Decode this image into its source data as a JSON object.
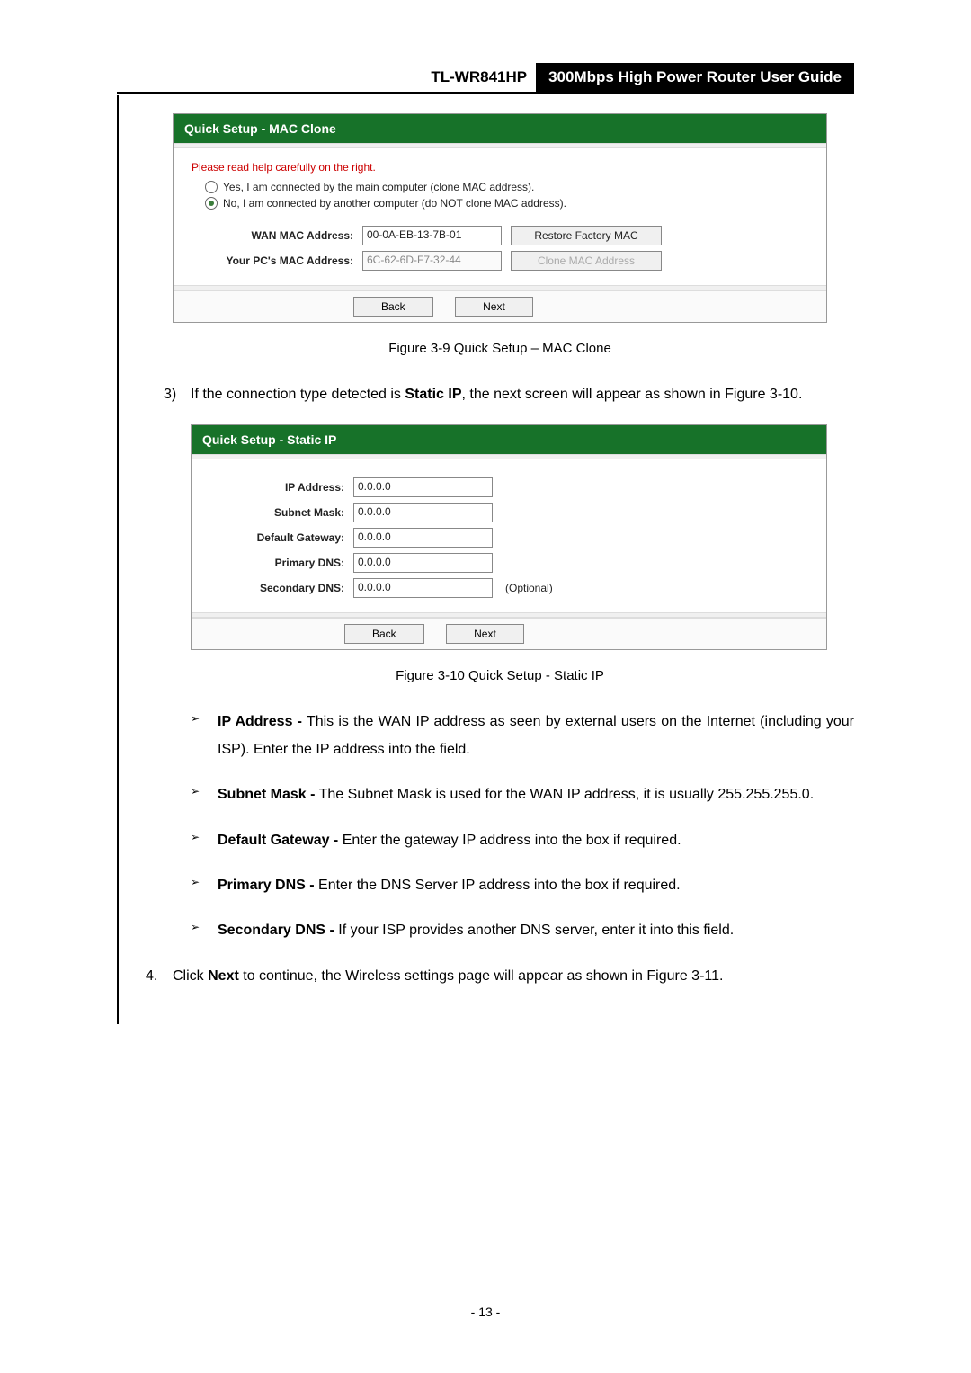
{
  "header": {
    "model": "TL-WR841HP",
    "guide": "300Mbps High Power Router User Guide"
  },
  "mac_clone_box": {
    "title": "Quick Setup - MAC Clone",
    "help": "Please read help carefully on the right.",
    "radio_yes": "Yes, I am connected by the main computer (clone MAC address).",
    "radio_no": "No, I am connected by another computer (do NOT clone MAC address).",
    "wan_label": "WAN MAC Address:",
    "wan_value": "00-0A-EB-13-7B-01",
    "wan_btn": "Restore Factory MAC",
    "pc_label": "Your PC's MAC Address:",
    "pc_value": "6C-62-6D-F7-32-44",
    "pc_btn": "Clone MAC Address",
    "back": "Back",
    "next": "Next"
  },
  "fig39": "Figure 3-9    Quick Setup – MAC Clone",
  "step3_num": "3)",
  "step3_pre": "If  the  connection  type  detected  is  ",
  "step3_bold": "Static  IP",
  "step3_post": ",  the  next  screen  will  appear  as  shown  in Figure 3-10.",
  "static_box": {
    "title": "Quick Setup - Static IP",
    "ip_label": "IP Address:",
    "ip_value": "0.0.0.0",
    "mask_label": "Subnet Mask:",
    "mask_value": "0.0.0.0",
    "gw_label": "Default Gateway:",
    "gw_value": "0.0.0.0",
    "dns1_label": "Primary DNS:",
    "dns1_value": "0.0.0.0",
    "dns2_label": "Secondary DNS:",
    "dns2_value": "0.0.0.0",
    "optional": "(Optional)",
    "back": "Back",
    "next": "Next"
  },
  "fig310": "Figure 3-10    Quick Setup - Static IP",
  "bullets": {
    "ip_b": "IP  Address  -",
    "ip_t": " This  is  the  WAN  IP  address  as  seen  by  external  users  on  the  Internet (including your ISP). Enter the IP address into the field.",
    "mask_b": "Subnet  Mask  -",
    "mask_t": " The  Subnet  Mask  is  used  for  the  WAN  IP  address,  it  is  usually 255.255.255.0.",
    "gw_b": "Default Gateway -",
    "gw_t": " Enter the gateway IP address into the box if required.",
    "dns1_b": "Primary DNS -",
    "dns1_t": " Enter the DNS Server IP address into the box if required.",
    "dns2_b": "Secondary DNS -",
    "dns2_t": " If your ISP provides another DNS server, enter it into this field."
  },
  "step4_num": "4.",
  "step4_pre": "Click ",
  "step4_bold": "Next",
  "step4_post": " to continue, the Wireless settings page will appear as shown in Figure 3-11.",
  "page_number": "- 13 -"
}
